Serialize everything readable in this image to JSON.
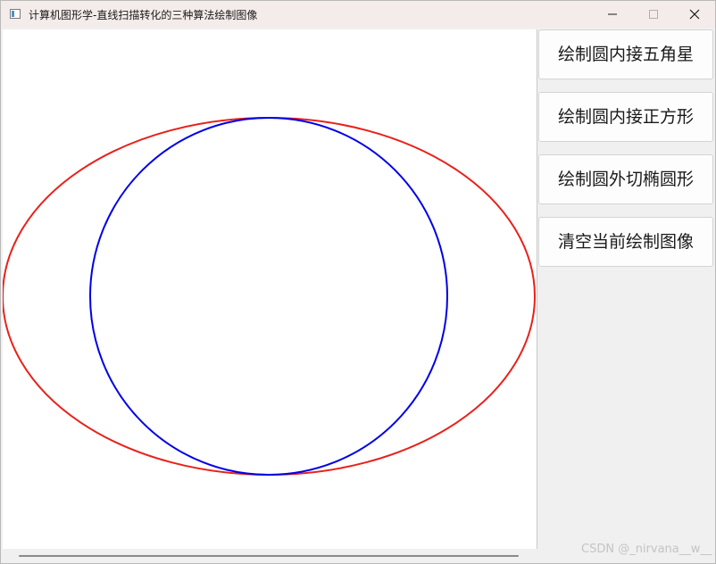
{
  "window": {
    "title": "计算机图形学-直线扫描转化的三种算法绘制图像",
    "controls": {
      "minimize_icon": "minimize-icon",
      "maximize_icon": "maximize-icon",
      "close_icon": "close-icon"
    }
  },
  "canvas": {
    "shapes": [
      {
        "kind": "ellipse",
        "color": "#e8211a"
      },
      {
        "kind": "circle",
        "color": "#0000e8"
      }
    ]
  },
  "sidebar": {
    "buttons": [
      {
        "label": "绘制圆内接五角星"
      },
      {
        "label": "绘制圆内接正方形"
      },
      {
        "label": "绘制圆外切椭圆形"
      },
      {
        "label": "清空当前绘制图像"
      }
    ]
  },
  "watermark": "CSDN @_nirvana__w__"
}
